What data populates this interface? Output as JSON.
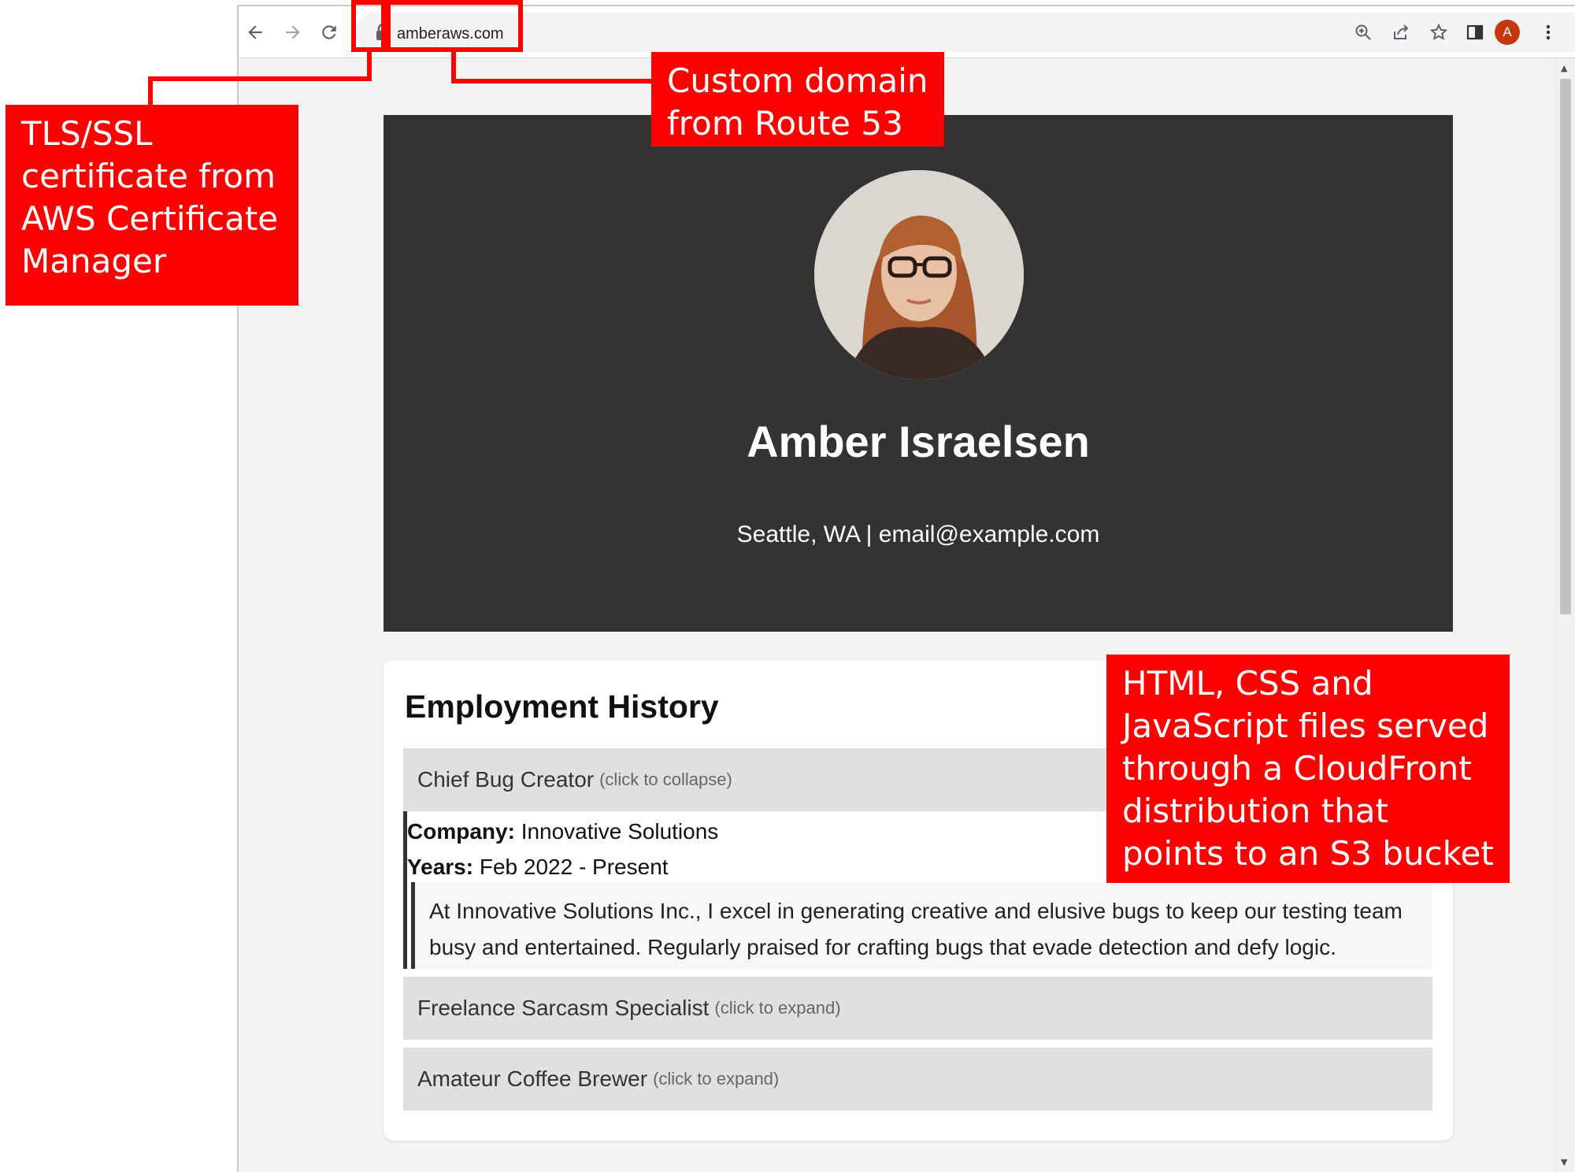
{
  "browser": {
    "url": "amberaws.com",
    "profile_initial": "A",
    "toolbar_icons": [
      "back-icon",
      "forward-icon",
      "reload-icon",
      "lock-icon",
      "zoom-icon",
      "share-icon",
      "star-icon",
      "side-panel-icon",
      "menu-icon"
    ]
  },
  "hero": {
    "name": "Amber Israelsen",
    "contact": "Seattle, WA | email@example.com"
  },
  "employment": {
    "title": "Employment History",
    "jobs": [
      {
        "title": "Chief Bug Creator",
        "hint": "(click to collapse)",
        "company_label": "Company:",
        "company": "Innovative Solutions",
        "years_label": "Years:",
        "years": "Feb 2022 - Present",
        "description": "At Innovative Solutions Inc., I excel in generating creative and elusive bugs to keep our testing team busy and entertained. Regularly praised for crafting bugs that evade detection and defy logic."
      },
      {
        "title": "Freelance Sarcasm Specialist",
        "hint": "(click to expand)"
      },
      {
        "title": "Amateur Coffee Brewer",
        "hint": "(click to expand)"
      }
    ]
  },
  "annotations": {
    "tls": "TLS/SSL certificate from AWS Certificate Manager",
    "domain": "Custom domain from Route 53",
    "cloudfront": "HTML, CSS and JavaScript files served through a CloudFront distribution that points to an S3 bucket"
  },
  "colors": {
    "annotation_red": "#ff0000",
    "hero_background": "#333333",
    "job_header_background": "#e0e0e0",
    "avatar": "#c5370d"
  }
}
